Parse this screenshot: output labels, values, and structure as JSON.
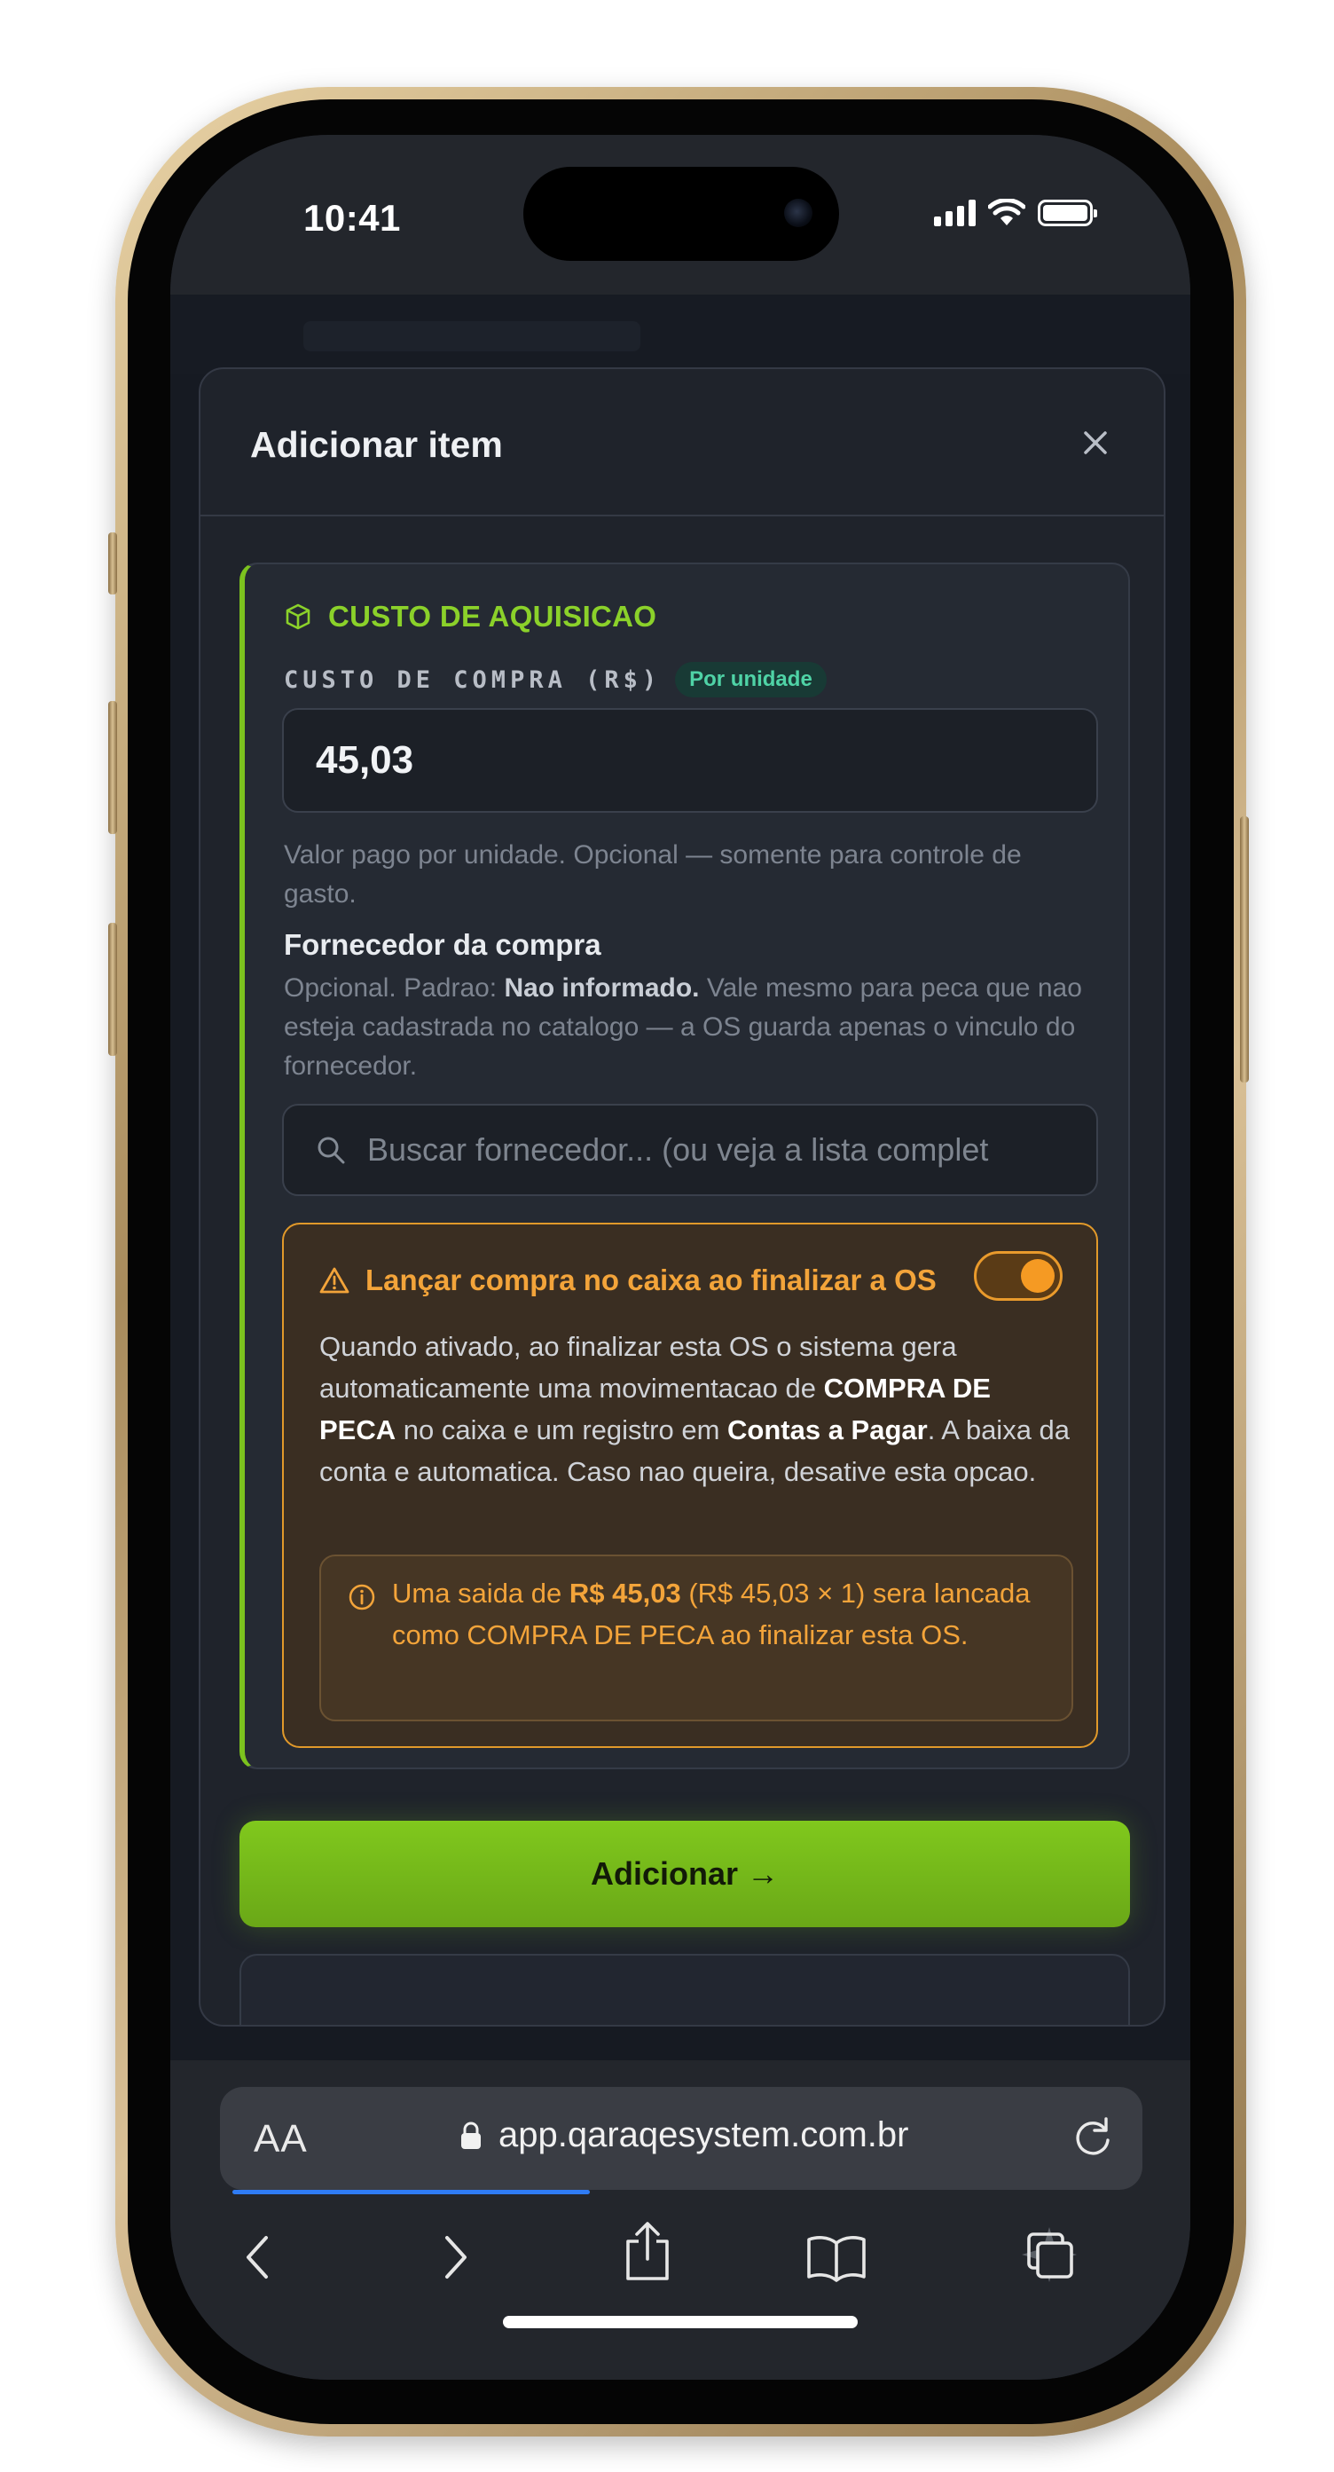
{
  "status_bar": {
    "time": "10:41"
  },
  "modal": {
    "title": "Adicionar item",
    "close_label": "×"
  },
  "section": {
    "title": "CUSTO DE AQUISICAO",
    "cost_label": "CUSTO DE COMPRA (R$)",
    "unit_pill": "Por unidade",
    "cost_value": "45,03",
    "cost_help": "Valor pago por unidade. Opcional — somente para controle de gasto.",
    "supplier_title": "Fornecedor da compra",
    "supplier_help_prefix": "Opcional. Padrao: ",
    "supplier_help_bold": "Nao informado.",
    "supplier_help_suffix": " Vale mesmo para peca que nao esteja cadastrada no catalogo — a OS guarda apenas o vinculo do fornecedor.",
    "search_placeholder": "Buscar fornecedor... (ou veja a lista complet"
  },
  "warning": {
    "title": "Lançar compra no caixa ao finalizar a OS",
    "toggle_on": true,
    "body_1": "Quando ativado, ao finalizar esta OS o sistema gera automaticamente uma movimentacao de ",
    "body_bold_1": "COMPRA DE PECA",
    "body_2": " no caixa e um registro em ",
    "body_bold_2": "Contas a Pagar",
    "body_3": ". A baixa da conta e automatica. Caso nao queira, desative esta opcao.",
    "info_1": "Uma saida de ",
    "info_bold_1": "R$ 45,03",
    "info_2": " (R$ 45,03 × 1)",
    "info_3": " sera lancada como COMPRA DE PECA ao finalizar esta OS."
  },
  "add_button_label": "Adicionar →",
  "browser": {
    "aa_label": "AA",
    "url": "app.qaraqesystem.com.br",
    "load_progress": 0.25
  },
  "colors": {
    "accent_green": "#7cc21e",
    "warning_orange": "#f3a43a",
    "pill_teal": "#4fd3a6",
    "link_blue": "#2f7cf5"
  },
  "icons": {
    "section": "box-icon",
    "warning": "warning-triangle-icon",
    "info": "info-circle-icon",
    "search": "search-icon",
    "close": "close-icon",
    "lock": "lock-icon",
    "reload": "reload-icon",
    "back": "chevron-left-icon",
    "forward": "chevron-right-icon",
    "share": "share-icon",
    "bookmarks": "book-icon",
    "tabs": "tabs-icon"
  }
}
